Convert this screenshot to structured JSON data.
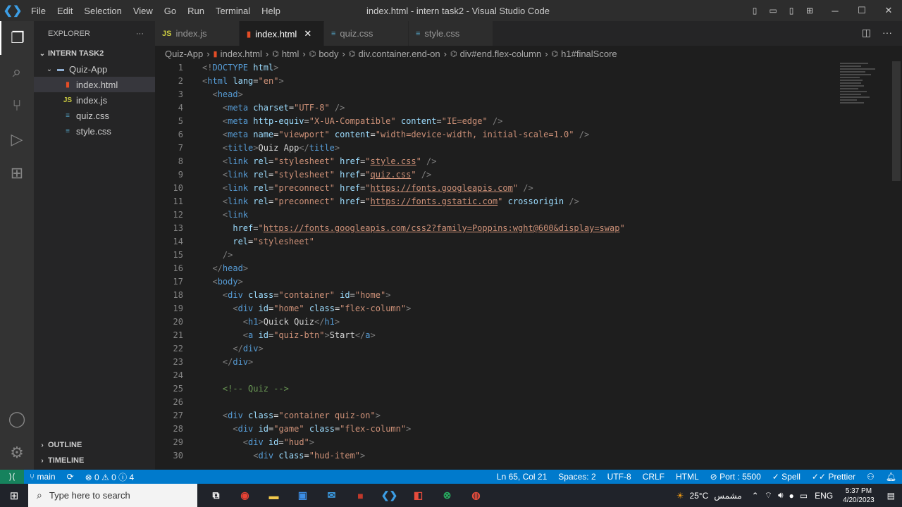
{
  "titlebar": {
    "menus": [
      "File",
      "Edit",
      "Selection",
      "View",
      "Go",
      "Run",
      "Terminal",
      "Help"
    ],
    "title": "index.html - intern task2 - Visual Studio Code"
  },
  "sidebar": {
    "header": "EXPLORER",
    "workspace": "INTERN TASK2",
    "folder": "Quiz-App",
    "files": [
      {
        "name": "index.html",
        "icon": "html-file-icon"
      },
      {
        "name": "index.js",
        "icon": "js-file-icon"
      },
      {
        "name": "quiz.css",
        "icon": "css-file-icon"
      },
      {
        "name": "style.css",
        "icon": "css-file-icon"
      }
    ],
    "outline": "OUTLINE",
    "timeline": "TIMELINE"
  },
  "tabs": [
    {
      "label": "index.js",
      "icon": "js-file-icon",
      "active": false
    },
    {
      "label": "index.html",
      "icon": "html-file-icon",
      "active": true
    },
    {
      "label": "quiz.css",
      "icon": "css-file-icon",
      "active": false
    },
    {
      "label": "style.css",
      "icon": "css-file-icon",
      "active": false
    }
  ],
  "breadcrumb": [
    "Quiz-App",
    "index.html",
    "html",
    "body",
    "div.container.end-on",
    "div#end.flex-column",
    "h1#finalScore"
  ],
  "code_lines": [
    {
      "n": "1",
      "t": "<!DOCTYPE html>"
    },
    {
      "n": "2",
      "t": "<html lang=\"en\">"
    },
    {
      "n": "3",
      "t": "  <head>"
    },
    {
      "n": "4",
      "t": "    <meta charset=\"UTF-8\" />"
    },
    {
      "n": "5",
      "t": "    <meta http-equiv=\"X-UA-Compatible\" content=\"IE=edge\" />"
    },
    {
      "n": "6",
      "t": "    <meta name=\"viewport\" content=\"width=device-width, initial-scale=1.0\" />"
    },
    {
      "n": "7",
      "t": "    <title>Quiz App</title>"
    },
    {
      "n": "8",
      "t": "    <link rel=\"stylesheet\" href=\"style.css\" />"
    },
    {
      "n": "9",
      "t": "    <link rel=\"stylesheet\" href=\"quiz.css\" />"
    },
    {
      "n": "10",
      "t": "    <link rel=\"preconnect\" href=\"https://fonts.googleapis.com\" />"
    },
    {
      "n": "11",
      "t": "    <link rel=\"preconnect\" href=\"https://fonts.gstatic.com\" crossorigin />"
    },
    {
      "n": "12",
      "t": "    <link"
    },
    {
      "n": "13",
      "t": "      href=\"https://fonts.googleapis.com/css2?family=Poppins:wght@600&display=swap\""
    },
    {
      "n": "14",
      "t": "      rel=\"stylesheet\""
    },
    {
      "n": "15",
      "t": "    />"
    },
    {
      "n": "16",
      "t": "  </head>"
    },
    {
      "n": "17",
      "t": "  <body>"
    },
    {
      "n": "18",
      "t": "    <div class=\"container\" id=\"home\">"
    },
    {
      "n": "19",
      "t": "      <div id=\"home\" class=\"flex-column\">"
    },
    {
      "n": "20",
      "t": "        <h1>Quick Quiz</h1>"
    },
    {
      "n": "21",
      "t": "        <a id=\"quiz-btn\">Start</a>"
    },
    {
      "n": "22",
      "t": "      </div>"
    },
    {
      "n": "23",
      "t": "    </div>"
    },
    {
      "n": "24",
      "t": ""
    },
    {
      "n": "25",
      "t": "    <!-- Quiz -->"
    },
    {
      "n": "26",
      "t": ""
    },
    {
      "n": "27",
      "t": "    <div class=\"container quiz-on\">"
    },
    {
      "n": "28",
      "t": "      <div id=\"game\" class=\"flex-column\">"
    },
    {
      "n": "29",
      "t": "        <div id=\"hud\">"
    },
    {
      "n": "30",
      "t": "          <div class=\"hud-item\">"
    }
  ],
  "statusbar": {
    "branch": "main",
    "problems": "0 ⚠ 0 ⓘ 4",
    "position": "Ln 65, Col 21",
    "spaces": "Spaces: 2",
    "encoding": "UTF-8",
    "eol": "CRLF",
    "language": "HTML",
    "port": "Port : 5500",
    "spell": "Spell",
    "prettier": "Prettier"
  },
  "taskbar": {
    "search_placeholder": "Type here to search",
    "weather": "25°C",
    "weather_label": "مشمس",
    "lang": "ENG",
    "time": "5:37 PM",
    "date": "4/20/2023"
  },
  "colors": {
    "accent": "#007acc",
    "titlebar": "#2d2d2d",
    "sidebar": "#252526",
    "editor": "#1e1e1e"
  }
}
